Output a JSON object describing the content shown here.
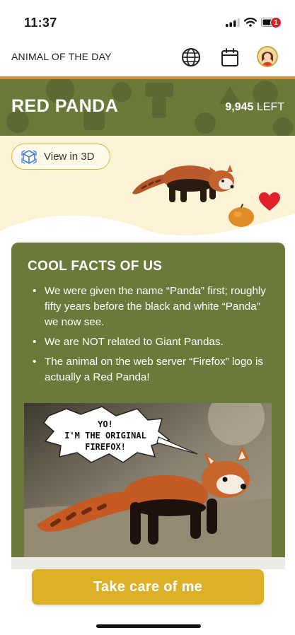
{
  "status_bar": {
    "time": "11:37",
    "icons": [
      "signal-icon",
      "wifi-icon",
      "battery-icon"
    ]
  },
  "header": {
    "title": "ANIMAL OF THE DAY",
    "icons": [
      "globe-icon",
      "calendar-icon",
      "avatar"
    ],
    "notification_count": "1"
  },
  "banner": {
    "title": "RED PANDA",
    "count": "9,945",
    "count_suffix": "LEFT"
  },
  "hero": {
    "view_3d_label": "View in 3D",
    "favorite_icon": "heart-icon"
  },
  "facts": {
    "title": "COOL FACTS OF US",
    "items": [
      "We were given the name “Panda” first; roughly fifty years before the black and white “Panda” we now see.",
      "We are NOT related to Giant Pandas.",
      "The animal on the web server “Firefox” logo is actually a Red Panda!"
    ],
    "speech_bubble": [
      "YO!",
      "I'M THE ORIGINAL",
      "FIREFOX!"
    ]
  },
  "cta": {
    "label": "Take care of me"
  },
  "colors": {
    "olive": "#6b7a3b",
    "gold": "#dcb027",
    "cream": "#fbf3d6",
    "heart": "#e0202a",
    "rule": "#c9943c"
  }
}
